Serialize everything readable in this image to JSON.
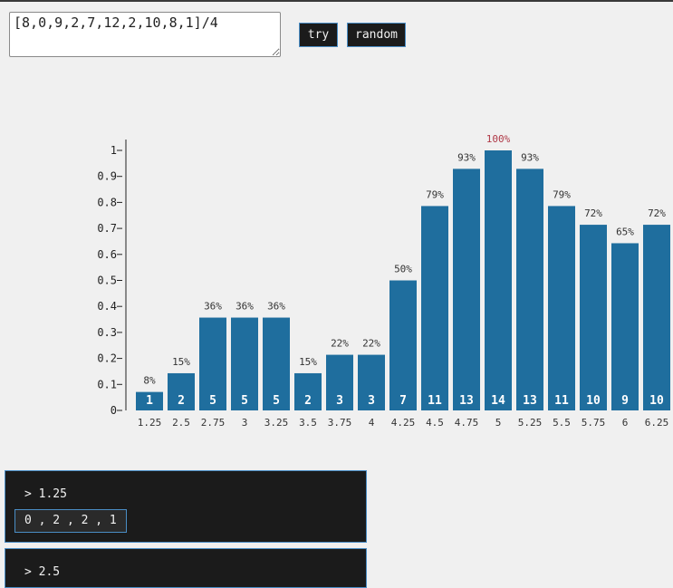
{
  "input": {
    "value": "[8,0,9,2,7,12,2,10,8,1]/4"
  },
  "buttons": {
    "try": "try",
    "random": "random"
  },
  "chart_data": {
    "type": "bar",
    "categories": [
      "1.25",
      "2.5",
      "2.75",
      "3",
      "3.25",
      "3.5",
      "3.75",
      "4",
      "4.25",
      "4.5",
      "4.75",
      "5",
      "5.25",
      "5.5",
      "5.75",
      "6",
      "6.25"
    ],
    "values": [
      1,
      2,
      5,
      5,
      5,
      2,
      3,
      3,
      7,
      11,
      13,
      14,
      13,
      11,
      10,
      9,
      10
    ],
    "percent_labels": [
      "8%",
      "15%",
      "36%",
      "36%",
      "36%",
      "15%",
      "22%",
      "22%",
      "50%",
      "79%",
      "93%",
      "100%",
      "93%",
      "79%",
      "72%",
      "65%",
      "72%"
    ],
    "relative_heights": [
      0.071,
      0.143,
      0.357,
      0.357,
      0.357,
      0.143,
      0.214,
      0.214,
      0.5,
      0.786,
      0.929,
      1,
      0.929,
      0.786,
      0.714,
      0.643,
      0.714
    ],
    "y_ticks": [
      "0",
      "0.1",
      "0.2",
      "0.3",
      "0.4",
      "0.5",
      "0.6",
      "0.7",
      "0.8",
      "0.9",
      "1"
    ],
    "ylim": [
      0,
      1
    ],
    "highlight_index": 11,
    "colors": {
      "bar": "#1f6e9e",
      "highlight_label": "#b03a48",
      "text": "#333333"
    }
  },
  "panels": [
    {
      "header": "> 1.25",
      "combo": "0 , 2 , 2 , 1"
    },
    {
      "header": "> 2.5"
    }
  ]
}
